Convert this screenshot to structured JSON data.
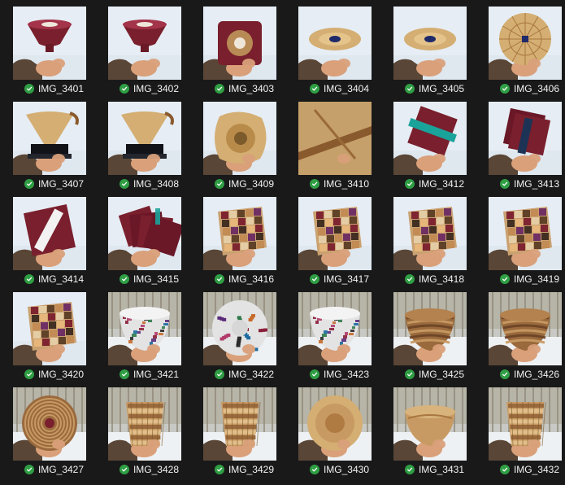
{
  "grid": {
    "items": [
      {
        "label": "IMG_3401",
        "status": "synced",
        "status_icon": "check-circle-icon",
        "subject": "red-epoxy-vase"
      },
      {
        "label": "IMG_3402",
        "status": "synced",
        "status_icon": "check-circle-icon",
        "subject": "red-epoxy-vase"
      },
      {
        "label": "IMG_3403",
        "status": "synced",
        "status_icon": "check-circle-icon",
        "subject": "red-square-bowl"
      },
      {
        "label": "IMG_3404",
        "status": "synced",
        "status_icon": "check-circle-icon",
        "subject": "light-wood-plate"
      },
      {
        "label": "IMG_3405",
        "status": "synced",
        "status_icon": "check-circle-icon",
        "subject": "light-wood-plate"
      },
      {
        "label": "IMG_3406",
        "status": "synced",
        "status_icon": "check-circle-icon",
        "subject": "segmented-plate"
      },
      {
        "label": "IMG_3407",
        "status": "synced",
        "status_icon": "check-circle-icon",
        "subject": "wood-vase-on-stand"
      },
      {
        "label": "IMG_3408",
        "status": "synced",
        "status_icon": "check-circle-icon",
        "subject": "wood-vase-on-stand"
      },
      {
        "label": "IMG_3409",
        "status": "synced",
        "status_icon": "check-circle-icon",
        "subject": "natural-edge-bowl"
      },
      {
        "label": "IMG_3410",
        "status": "synced",
        "status_icon": "check-circle-icon",
        "subject": "wood-vase-closeup"
      },
      {
        "label": "IMG_3412",
        "status": "synced",
        "status_icon": "check-circle-icon",
        "subject": "red-coaster-teal"
      },
      {
        "label": "IMG_3413",
        "status": "synced",
        "status_icon": "check-circle-icon",
        "subject": "red-coasters-stack"
      },
      {
        "label": "IMG_3414",
        "status": "synced",
        "status_icon": "check-circle-icon",
        "subject": "red-coaster-white"
      },
      {
        "label": "IMG_3415",
        "status": "synced",
        "status_icon": "check-circle-icon",
        "subject": "red-coasters-fan"
      },
      {
        "label": "IMG_3416",
        "status": "synced",
        "status_icon": "check-circle-icon",
        "subject": "mosaic-tray"
      },
      {
        "label": "IMG_3417",
        "status": "synced",
        "status_icon": "check-circle-icon",
        "subject": "mosaic-tray"
      },
      {
        "label": "IMG_3418",
        "status": "synced",
        "status_icon": "check-circle-icon",
        "subject": "mosaic-tray"
      },
      {
        "label": "IMG_3419",
        "status": "synced",
        "status_icon": "check-circle-icon",
        "subject": "mosaic-tray"
      },
      {
        "label": "IMG_3420",
        "status": "synced",
        "status_icon": "check-circle-icon",
        "subject": "mosaic-tray"
      },
      {
        "label": "IMG_3421",
        "status": "synced",
        "status_icon": "check-circle-icon",
        "subject": "confetti-bowl"
      },
      {
        "label": "IMG_3422",
        "status": "synced",
        "status_icon": "check-circle-icon",
        "subject": "confetti-bowl-top"
      },
      {
        "label": "IMG_3423",
        "status": "synced",
        "status_icon": "check-circle-icon",
        "subject": "confetti-bowl"
      },
      {
        "label": "IMG_3425",
        "status": "synced",
        "status_icon": "check-circle-icon",
        "subject": "segmented-bowl"
      },
      {
        "label": "IMG_3426",
        "status": "synced",
        "status_icon": "check-circle-icon",
        "subject": "segmented-bowl"
      },
      {
        "label": "IMG_3427",
        "status": "synced",
        "status_icon": "check-circle-icon",
        "subject": "segmented-bowl-top"
      },
      {
        "label": "IMG_3428",
        "status": "synced",
        "status_icon": "check-circle-icon",
        "subject": "segmented-vase"
      },
      {
        "label": "IMG_3429",
        "status": "synced",
        "status_icon": "check-circle-icon",
        "subject": "segmented-vase"
      },
      {
        "label": "IMG_3430",
        "status": "synced",
        "status_icon": "check-circle-icon",
        "subject": "wood-bowl-top"
      },
      {
        "label": "IMG_3431",
        "status": "synced",
        "status_icon": "check-circle-icon",
        "subject": "wood-bowl"
      },
      {
        "label": "IMG_3432",
        "status": "synced",
        "status_icon": "check-circle-icon",
        "subject": "segmented-vase"
      }
    ]
  },
  "colors": {
    "background": "#191919",
    "caption_text": "#f2f2f2",
    "check_green": "#2f9e44",
    "snow": "#e6edf4",
    "winter_trees": "#8a8474",
    "skin": "#d9a07a",
    "sleeve": "#5a4636",
    "red_epoxy": "#7a1f2d",
    "light_wood": "#d4ae72",
    "dark_wood": "#8a5a2f"
  }
}
